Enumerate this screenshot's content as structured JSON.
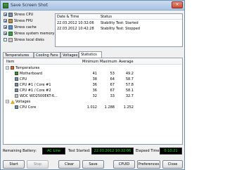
{
  "window": {
    "title": "Save Screen Shot",
    "close_glyph": "×",
    "icon": "flame-icon"
  },
  "checks": [
    {
      "label": "Stress CPU",
      "checked": true,
      "icon": "cpu-icon"
    },
    {
      "label": "Stress FPU",
      "checked": true,
      "icon": "fpu-icon"
    },
    {
      "label": "Stress cache",
      "checked": true,
      "icon": "cache-icon"
    },
    {
      "label": "Stress system memory",
      "checked": true,
      "icon": "memory-icon"
    },
    {
      "label": "Stress local disks",
      "checked": false,
      "icon": "disk-icon"
    }
  ],
  "log": {
    "headers": [
      "Date & Time",
      "Status"
    ],
    "rows": [
      {
        "datetime": "22.03.2012 10:32:06",
        "status": "Stability Test: Started"
      },
      {
        "datetime": "22.03.2012 10:42:28",
        "status": "Stability Test: Stopped"
      }
    ]
  },
  "tabs": [
    "Temperatures",
    "Cooling Fans",
    "Voltages",
    "Statistics"
  ],
  "active_tab": "Statistics",
  "stats": {
    "headers": {
      "item": "Item",
      "min": "Minimum",
      "max": "Maximum",
      "avg": "Average"
    },
    "rows": [
      {
        "name": "Temperatures",
        "min": "",
        "max": "",
        "avg": "",
        "level": 0,
        "icon": "temperature-icon",
        "group": true
      },
      {
        "name": "Motherboard",
        "min": "41",
        "max": "53",
        "avg": "49.2",
        "level": 1,
        "icon": "motherboard-icon"
      },
      {
        "name": "CPU",
        "min": "38",
        "max": "64",
        "avg": "58.7",
        "level": 1,
        "icon": "cpu-icon"
      },
      {
        "name": "CPU #1 / Core #1",
        "min": "36",
        "max": "67",
        "avg": "57.8",
        "level": 1,
        "icon": "cpu-icon"
      },
      {
        "name": "CPU #1 / Core #2",
        "min": "36",
        "max": "67",
        "avg": "58.1",
        "level": 1,
        "icon": "cpu-icon"
      },
      {
        "name": "WDC WD2500EKT-6...",
        "min": "32",
        "max": "33",
        "avg": "32.7",
        "level": 1,
        "icon": "disk-icon"
      },
      {
        "name": "Voltages",
        "min": "",
        "max": "",
        "avg": "",
        "level": 0,
        "icon": "voltage-icon",
        "group": true
      },
      {
        "name": "CPU Core",
        "min": "1.012",
        "max": "1.288",
        "avg": "1.252",
        "level": 1,
        "icon": "cpu-icon"
      }
    ]
  },
  "status": {
    "battery_label": "Remaining Battery:",
    "battery_value": "AC Line",
    "started_label": "Test Started:",
    "started_value": "22.03.2012 10:32:06",
    "elapsed_label": "Elapsed Time:",
    "elapsed_value": "0:10:21"
  },
  "buttons": {
    "start": "Start",
    "stop": "Stop",
    "clear": "Clear",
    "save": "Save",
    "cpuid": "CPUID",
    "preferences": "Preferences",
    "close": "Close"
  },
  "colors": {
    "status_bg": "#000000",
    "status_text": "#26e11e"
  }
}
